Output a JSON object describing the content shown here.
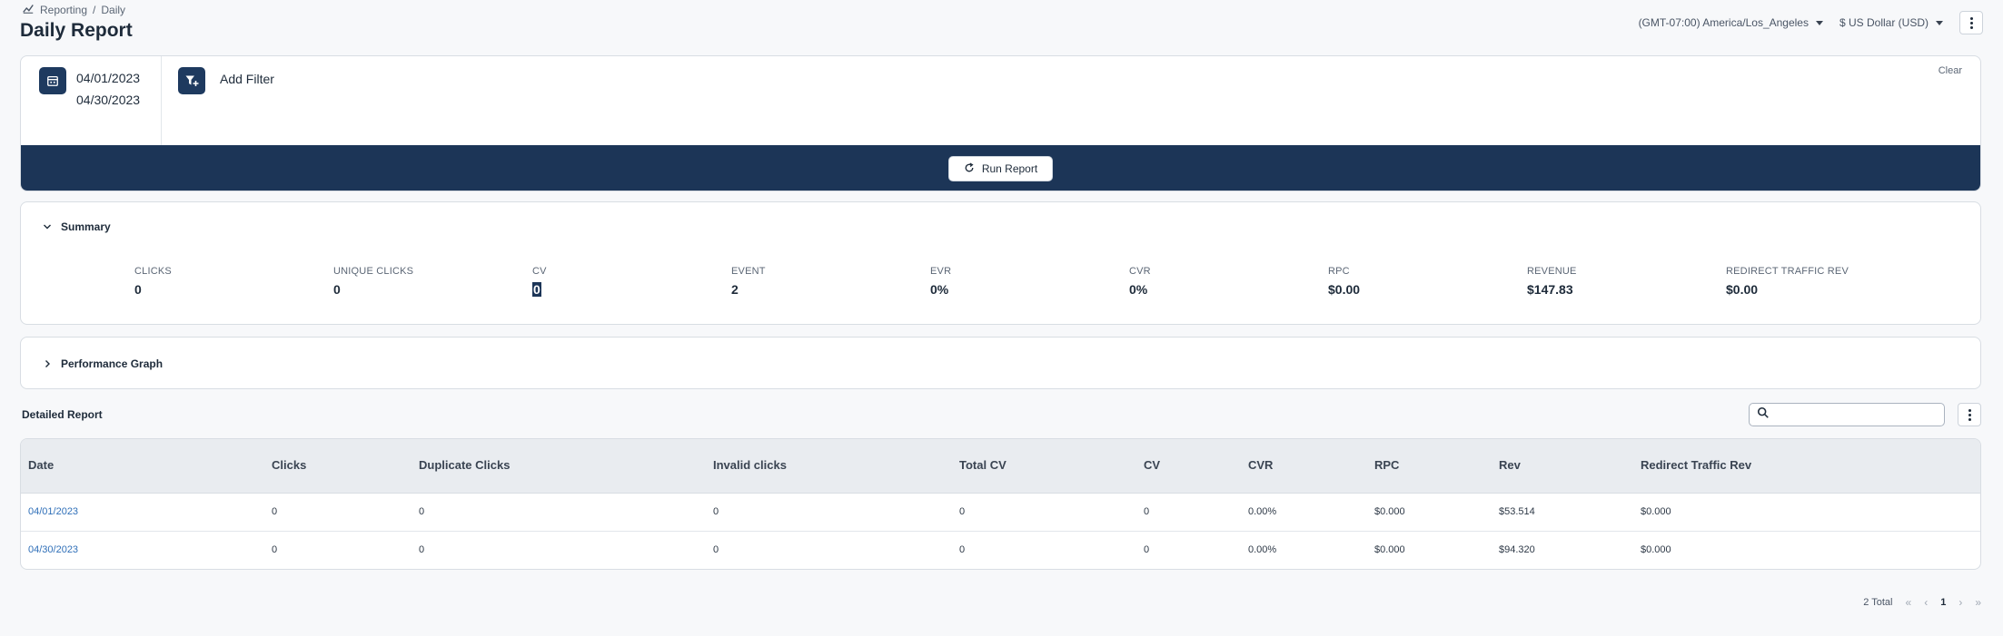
{
  "breadcrumb": {
    "parent": "Reporting",
    "separator": "/",
    "current": "Daily"
  },
  "page_title": "Daily Report",
  "header": {
    "timezone": "(GMT-07:00) America/Los_Angeles",
    "currency": "$ US Dollar (USD)"
  },
  "filters": {
    "date_start": "04/01/2023",
    "date_end": "04/30/2023",
    "add_filter_label": "Add Filter",
    "clear_label": "Clear",
    "run_report_label": "Run Report"
  },
  "summary": {
    "title": "Summary",
    "metrics": [
      {
        "label": "CLICKS",
        "value": "0"
      },
      {
        "label": "UNIQUE CLICKS",
        "value": "0"
      },
      {
        "label": "CV",
        "value": "0"
      },
      {
        "label": "EVENT",
        "value": "2"
      },
      {
        "label": "EVR",
        "value": "0%"
      },
      {
        "label": "CVR",
        "value": "0%"
      },
      {
        "label": "RPC",
        "value": "$0.00"
      },
      {
        "label": "REVENUE",
        "value": "$147.83"
      },
      {
        "label": "REDIRECT TRAFFIC REV",
        "value": "$0.00"
      }
    ]
  },
  "performance_graph": {
    "title": "Performance Graph"
  },
  "detailed_report": {
    "title": "Detailed Report",
    "search_placeholder": "",
    "columns": [
      "Date",
      "Clicks",
      "Duplicate Clicks",
      "Invalid clicks",
      "Total CV",
      "CV",
      "CVR",
      "RPC",
      "Rev",
      "Redirect Traffic Rev"
    ],
    "rows": [
      [
        "04/01/2023",
        "0",
        "0",
        "0",
        "0",
        "0",
        "0.00%",
        "$0.000",
        "$53.514",
        "$0.000"
      ],
      [
        "04/30/2023",
        "0",
        "0",
        "0",
        "0",
        "0",
        "0.00%",
        "$0.000",
        "$94.320",
        "$0.000"
      ]
    ]
  },
  "pagination": {
    "total": "2 Total",
    "current_page": "1",
    "first": "«",
    "prev": "‹",
    "next": "›",
    "last": "»"
  },
  "colors": {
    "navy": "#1c3557",
    "link": "#2f6fb8",
    "background": "#f7f8fa"
  },
  "icons": [
    "reporting-icon",
    "calendar-icon",
    "filter-add-icon",
    "refresh-icon",
    "chevron-down-icon",
    "chevron-right-icon",
    "search-icon",
    "kebab-icon"
  ]
}
